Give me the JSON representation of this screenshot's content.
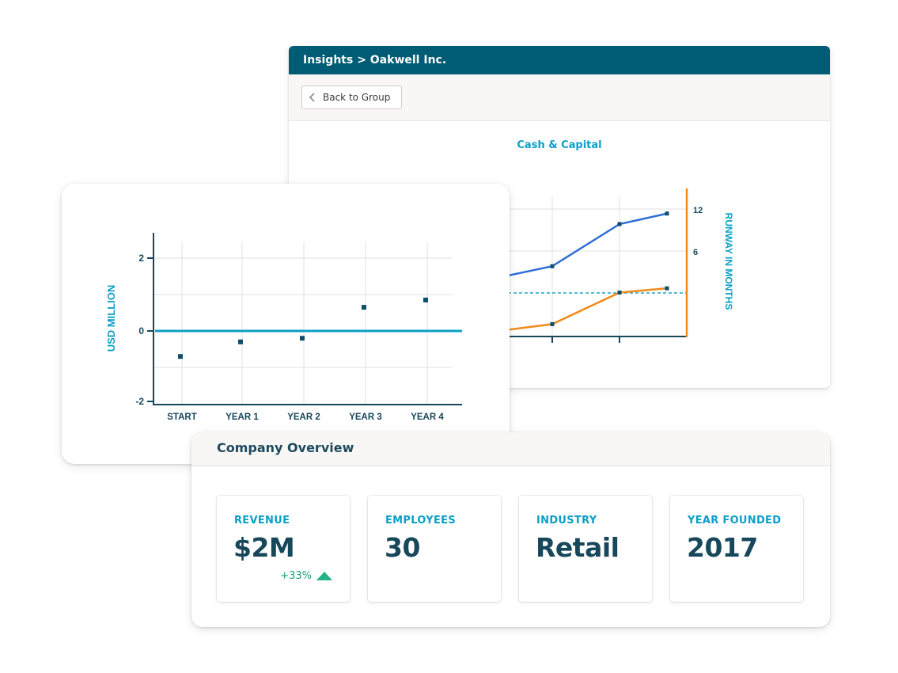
{
  "header": {
    "breadcrumb": "Insights > Oakwell Inc."
  },
  "toolbar": {
    "back_label": "Back to Group"
  },
  "cash_capital": {
    "title": "Cash & Capital",
    "right_axis_label": "RUNWAY IN MONTHS",
    "right_ticks": [
      "12",
      "6"
    ]
  },
  "left_chart": {
    "ylabel": "USD MILLION",
    "yticks": [
      "2",
      "0",
      "-2"
    ],
    "xticks": [
      "START",
      "YEAR 1",
      "YEAR 2",
      "YEAR 3",
      "YEAR 4"
    ]
  },
  "chart_data": [
    {
      "type": "scatter",
      "title": "",
      "xlabel": "",
      "ylabel": "USD MILLION",
      "categories": [
        "START",
        "YEAR 1",
        "YEAR 2",
        "YEAR 3",
        "YEAR 4"
      ],
      "values": [
        -0.7,
        -0.3,
        -0.2,
        0.65,
        0.85
      ],
      "ylim": [
        -2,
        2
      ],
      "grid": true
    },
    {
      "type": "line",
      "title": "Cash & Capital",
      "ylabel": "RUNWAY IN MONTHS",
      "series": [
        {
          "values": [
            5.6,
            6.6,
            10.6,
            11.6
          ]
        },
        {
          "values": [
            0.5,
            1.1,
            4.1,
            4.5
          ]
        }
      ],
      "yticks": [
        6,
        12
      ],
      "grid": true
    }
  ],
  "overview": {
    "title": "Company Overview",
    "stats": [
      {
        "label": "REVENUE",
        "value": "$2M",
        "delta": "+33%"
      },
      {
        "label": "EMPLOYEES",
        "value": "30"
      },
      {
        "label": "INDUSTRY",
        "value": "Retail"
      },
      {
        "label": "YEAR FOUNDED",
        "value": "2017"
      }
    ]
  },
  "colors": {
    "header": "#005b74",
    "accent": "#0aa0c7",
    "dark": "#17475b",
    "line_blue": "#2f6fd6",
    "line_orange": "#f08a1a",
    "positive": "#1a9e7a"
  }
}
